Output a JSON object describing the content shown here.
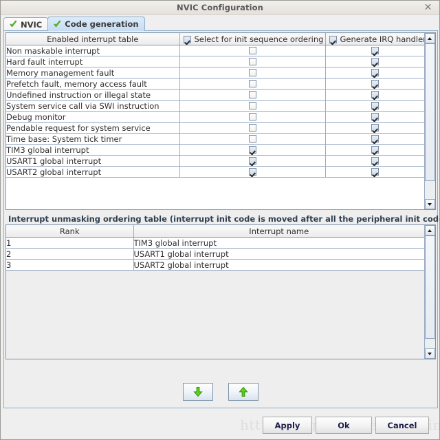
{
  "window": {
    "title": "NVIC Configuration",
    "close_icon": "close-icon"
  },
  "tabs": [
    {
      "label": "NVIC",
      "icon": "green-check-icon",
      "active": false
    },
    {
      "label": "Code generation",
      "icon": "green-check-icon",
      "active": true
    }
  ],
  "interrupt_table": {
    "columns": [
      {
        "label": "Enabled interrupt table",
        "has_checkbox": false
      },
      {
        "label": "Select for init sequence ordering",
        "has_checkbox": true,
        "checked": true
      },
      {
        "label": "Generate IRQ handler",
        "has_checkbox": true,
        "checked": true
      }
    ],
    "rows": [
      {
        "name": "Non maskable interrupt",
        "select_init": false,
        "gen_irq": true
      },
      {
        "name": "Hard fault interrupt",
        "select_init": false,
        "gen_irq": true
      },
      {
        "name": "Memory management fault",
        "select_init": false,
        "gen_irq": true
      },
      {
        "name": "Prefetch fault, memory access fault",
        "select_init": false,
        "gen_irq": true
      },
      {
        "name": "Undefined instruction or illegal state",
        "select_init": false,
        "gen_irq": true
      },
      {
        "name": "System service call via SWI instruction",
        "select_init": false,
        "gen_irq": true
      },
      {
        "name": "Debug monitor",
        "select_init": false,
        "gen_irq": true
      },
      {
        "name": "Pendable request for system service",
        "select_init": false,
        "gen_irq": true
      },
      {
        "name": "Time base: System tick timer",
        "select_init": false,
        "gen_irq": true
      },
      {
        "name": "TIM3 global interrupt",
        "select_init": true,
        "gen_irq": true
      },
      {
        "name": "USART1 global interrupt",
        "select_init": true,
        "gen_irq": true
      },
      {
        "name": "USART2 global interrupt",
        "select_init": true,
        "gen_irq": true
      }
    ]
  },
  "ordering": {
    "title": "Interrupt unmasking ordering table (interrupt init code is moved after all the peripheral init code)",
    "columns": [
      "Rank",
      "Interrupt name"
    ],
    "rows": [
      {
        "rank": "1",
        "name": "TIM3 global interrupt"
      },
      {
        "rank": "2",
        "name": "USART1 global interrupt"
      },
      {
        "rank": "3",
        "name": "USART2 global interrupt"
      }
    ]
  },
  "move_buttons": [
    {
      "name": "move-down-button",
      "icon": "green-down-arrow-icon"
    },
    {
      "name": "move-up-button",
      "icon": "green-up-arrow-icon"
    }
  ],
  "dialog_buttons": {
    "apply": "Apply",
    "ok": "Ok",
    "cancel": "Cancel"
  },
  "watermark": "http://blog.csdn.net/odeming",
  "colors": {
    "accent_blue": "#8fadc9",
    "tab_active": "#c6dcf2",
    "check_green": "#4caf22",
    "grid_line": "#9badc4",
    "window_bg": "#efefef"
  }
}
